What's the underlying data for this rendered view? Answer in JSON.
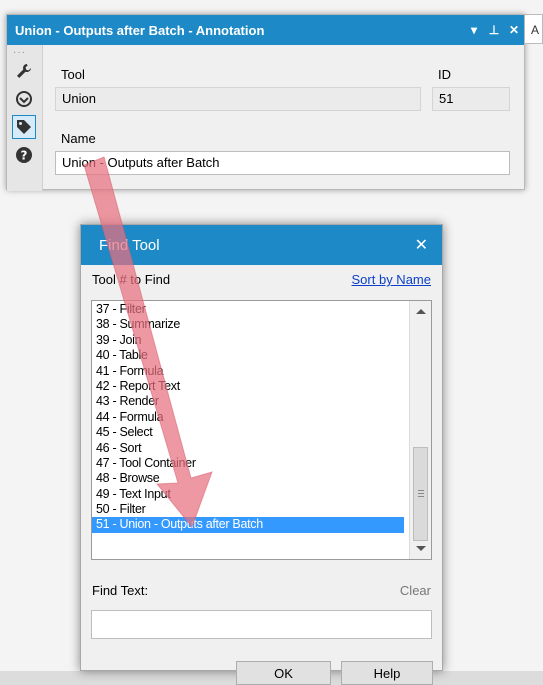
{
  "annotation_panel": {
    "title": "Union - Outputs after Batch  - Annotation",
    "controls": [
      "▾",
      "⊥",
      "✕"
    ],
    "sidebar_icons": [
      "wrench-icon",
      "target-icon",
      "tag-icon",
      "help-icon"
    ],
    "tool_label": "Tool",
    "tool_value": "Union",
    "id_label": "ID",
    "id_value": "51",
    "name_label": "Name",
    "name_value": "Union - Outputs after Batch"
  },
  "right_tab": {
    "label": "A"
  },
  "find_tool": {
    "title": "Find Tool",
    "close_glyph": "✕",
    "tool_number_label": "Tool # to Find",
    "sort_link": "Sort by Name",
    "items": [
      "37 - Filter",
      "38 - Summarize",
      "39 - Join",
      "40 - Table",
      "41 - Formula",
      "42 - Report Text",
      "43 - Render",
      "44 - Formula",
      "45 - Select",
      "46 - Sort",
      "47 - Tool Container",
      "48 - Browse",
      "49 - Text Input",
      "50 - Filter",
      "51 - Union - Outputs after Batch"
    ],
    "selected_index": 14,
    "find_text_label": "Find Text:",
    "clear_label": "Clear",
    "find_text_value": "",
    "buttons": [
      "OK",
      "Help"
    ]
  },
  "colors": {
    "title_bar": "#1d8ac7",
    "selection": "#3399ff",
    "link": "#0b3fc8",
    "arrow": "#e8707f"
  }
}
